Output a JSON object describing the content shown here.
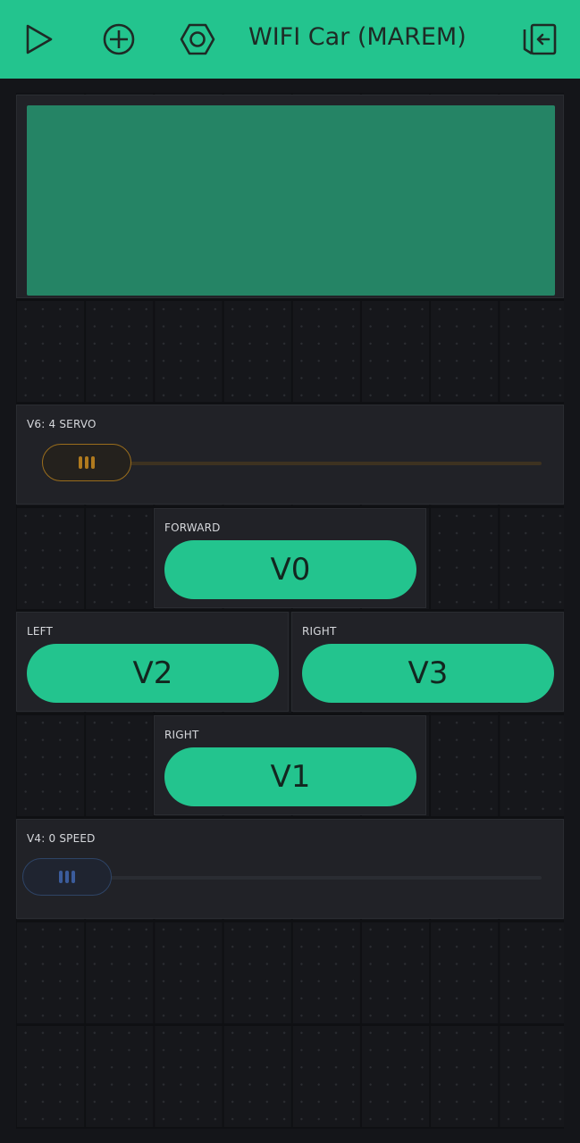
{
  "header": {
    "title": "WIFI Car (MAREM)",
    "icons": [
      "play-icon",
      "add-icon",
      "settings-icon",
      "exit-icon"
    ]
  },
  "widgets": {
    "lcd": {
      "color": "#258465"
    },
    "servo_slider": {
      "label": "V6: 4 SERVO",
      "value": 4,
      "accent": "#c48a23"
    },
    "forward_button": {
      "label": "FORWARD",
      "pin": "V0"
    },
    "left_button": {
      "label": "LEFT",
      "pin": "V2"
    },
    "right_button": {
      "label": "RIGHT",
      "pin": "V3"
    },
    "back_button": {
      "label": "RIGHT",
      "pin": "V1"
    },
    "speed_slider": {
      "label": "V4: 0 SPEED",
      "value": 0,
      "accent": "#3a5a9a"
    }
  },
  "colors": {
    "brand": "#23c48e",
    "background": "#141519",
    "widget": "#212227"
  }
}
